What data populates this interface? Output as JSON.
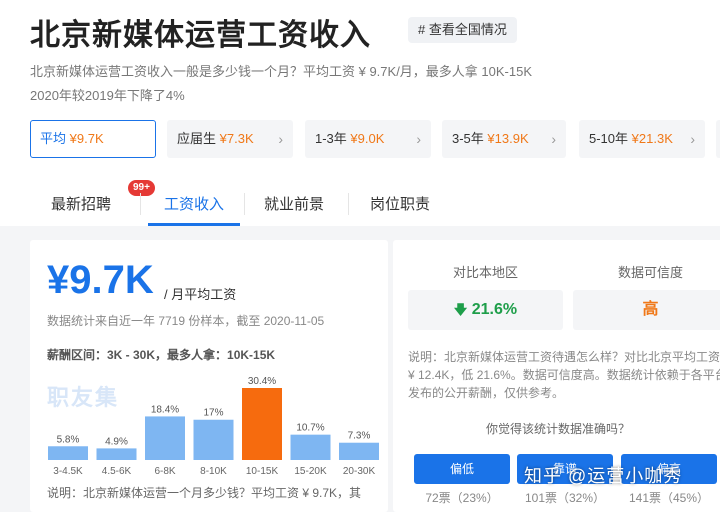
{
  "page": {
    "title": "北京新媒体运营工资收入",
    "tag_label": "# 查看全国情况",
    "desc_line1": "北京新媒体运营工资收入一般是多少钱一个月？平均工资 ¥ 9.7K/月，最多人拿 10K-15K",
    "desc_line2": "2020年较2019年下降了4%"
  },
  "summary_cards": [
    {
      "label": "平均",
      "value": "¥9.7K"
    },
    {
      "label": "应届生",
      "value": "¥7.3K"
    },
    {
      "label": "1-3年",
      "value": "¥9.0K"
    },
    {
      "label": "3-5年",
      "value": "¥13.9K"
    },
    {
      "label": "5-10年",
      "value": "¥21.3K"
    }
  ],
  "tabs": [
    {
      "label": "最新招聘",
      "badge": "99+"
    },
    {
      "label": "工资收入"
    },
    {
      "label": "就业前景"
    },
    {
      "label": "岗位职责"
    }
  ],
  "salary": {
    "big_value": "¥9.7K",
    "unit": "/ 月平均工资",
    "stat": "数据统计来自近一年 7719 份样本，截至 2020-11-05",
    "range": "薪酬区间：3K - 30K，最多人拿：10K-15K",
    "watermark": "职友集",
    "note": "说明：北京新媒体运营一个月多少钱？平均工资 ¥ 9.7K，其"
  },
  "chart_data": {
    "type": "bar",
    "categories": [
      "3-4.5K",
      "4.5-6K",
      "6-8K",
      "8-10K",
      "10-15K",
      "15-20K",
      "20-30K"
    ],
    "values": [
      5.8,
      4.9,
      18.4,
      17,
      30.4,
      10.7,
      7.3
    ],
    "labels": [
      "5.8%",
      "4.9%",
      "18.4%",
      "17%",
      "30.4%",
      "10.7%",
      "7.3%"
    ],
    "highlight_index": 4,
    "bar_color": "#7eb6f2",
    "highlight_color": "#f66b0e"
  },
  "compare": {
    "label_left": "对比本地区",
    "value_left": "21.6%",
    "arrow": "🡇",
    "label_right": "数据可信度",
    "value_right": "高",
    "note": "说明：北京新媒体运营工资待遇怎么样？对比北京平均工资 ¥ 12.4K，低 21.6%。数据可信度高。数据统计依赖于各平台发布的公开薪酬，仅供参考。",
    "question": "你觉得该统计数据准确吗？",
    "votes": [
      {
        "label": "偏低",
        "count": "72票（23%）"
      },
      {
        "label": "靠谱",
        "count": "101票（32%）"
      },
      {
        "label": "偏高",
        "count": "141票（45%）"
      }
    ]
  },
  "watermark_bottom": "知乎 @运营小咖秀"
}
